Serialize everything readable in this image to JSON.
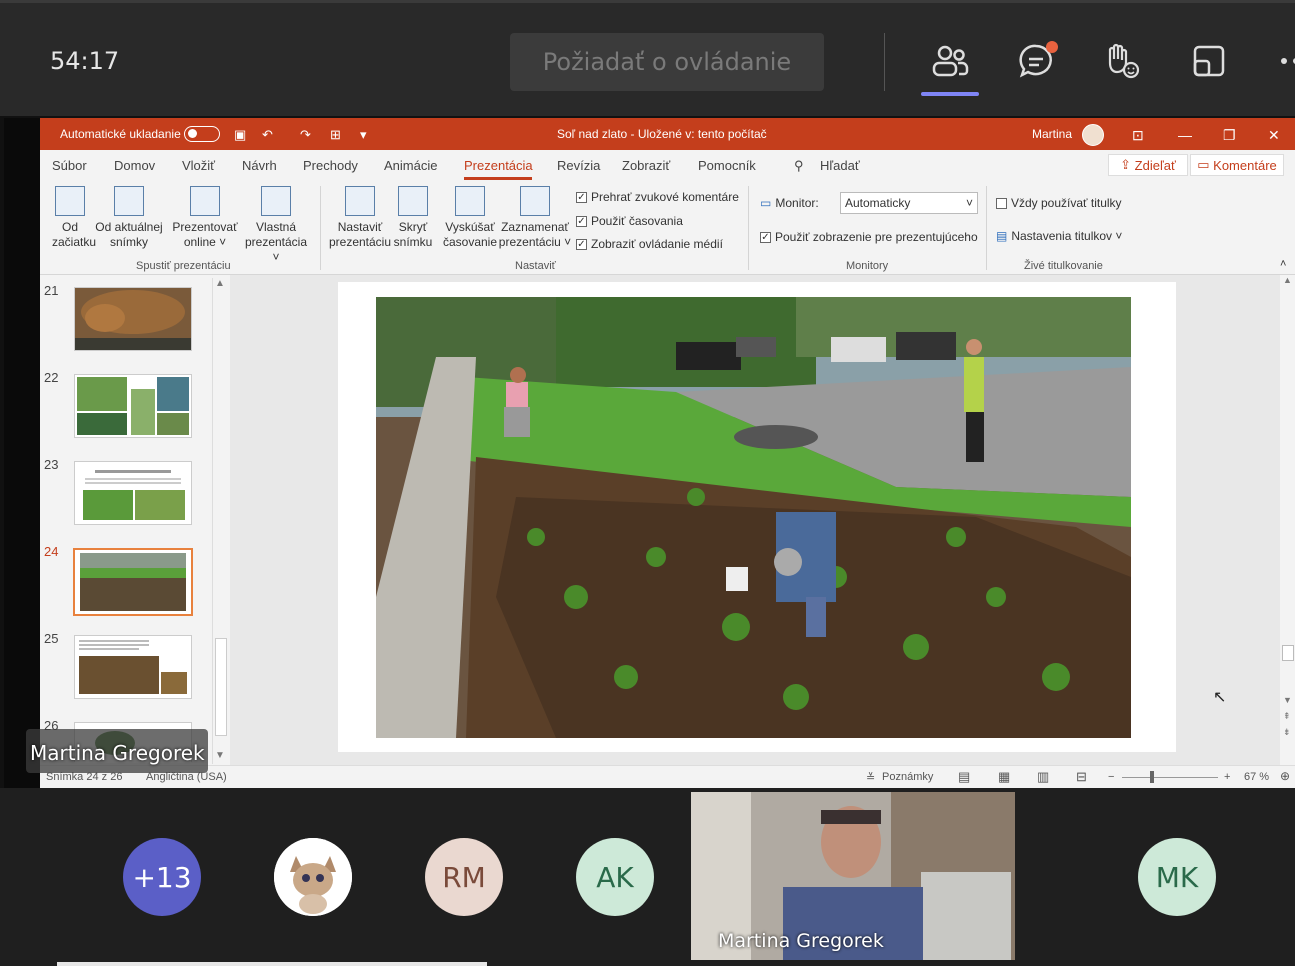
{
  "teams": {
    "timer": "54:17",
    "request_control_label": "Požiadať o ovládanie",
    "icons": [
      "people-icon",
      "chat-icon",
      "raise-hand-icon",
      "share-tray-icon",
      "more-icon"
    ]
  },
  "ppt": {
    "autosave_label": "Automatické ukladanie",
    "title": "Soľ nad zlato  -  Uložené v: tento počítač",
    "user": "Martina",
    "menu": [
      "Súbor",
      "Domov",
      "Vložiť",
      "Návrh",
      "Prechody",
      "Animácie",
      "Prezentácia",
      "Revízia",
      "Zobraziť",
      "Pomocník"
    ],
    "search_label": "Hľadať",
    "share_label": "Zdieľať",
    "comments_label": "Komentáre",
    "ribbon": {
      "b1": "Od",
      "b1b": "začiatku",
      "b2": "Od aktuálnej",
      "b2b": "snímky",
      "b3": "Prezentovať",
      "b3b": "online ˅",
      "b4": "Vlastná",
      "b4b": "prezentácia ˅",
      "group1": "Spustiť prezentáciu",
      "b5": "Nastaviť",
      "b5b": "prezentáciu",
      "b6": "Skryť",
      "b6b": "snímku",
      "b7": "Vyskúšať",
      "b7b": "časovanie",
      "b8": "Zaznamenať",
      "b8b": "prezentáciu ˅",
      "chk1": "Prehrať zvukové komentáre",
      "chk2": "Použiť časovania",
      "chk3": "Zobraziť ovládanie médií",
      "group2": "Nastaviť",
      "monitor_label": "Monitor:",
      "monitor_value": "Automaticky",
      "presenter_view": "Použiť zobrazenie pre prezentujúceho",
      "group3": "Monitory",
      "subs_always": "Vždy používať titulky",
      "subs_settings": "Nastavenia titulkov ˅",
      "group4": "Živé titulkovanie"
    },
    "thumb_numbers": [
      "21",
      "22",
      "23",
      "24",
      "25",
      "26"
    ],
    "status_slide": "Snímka 24 z 26",
    "status_lang": "Angličtina (USA)",
    "notes_label": "Poznámky",
    "zoom": "67 %"
  },
  "presenter_name": "Martina Gregorek",
  "participants": {
    "overflow": "+13",
    "rm": "RM",
    "ak": "AK",
    "mk": "MK",
    "video_name": "Martina Gregorek"
  }
}
